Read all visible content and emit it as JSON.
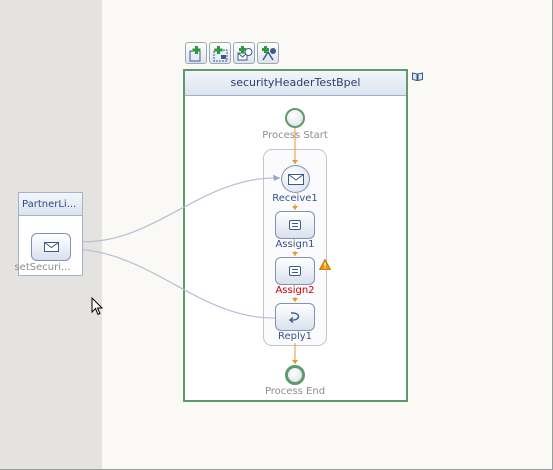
{
  "process": {
    "title": "securityHeaderTestBpel",
    "start_label": "Process Start",
    "end_label": "Process End"
  },
  "activities": {
    "receive_label": "Receive1",
    "assign1_label": "Assign1",
    "assign2_label": "Assign2",
    "reply_label": "Reply1"
  },
  "partner_link": {
    "title": "PartnerLi...",
    "operation_label": "setSecuri..."
  },
  "toolbar": {
    "buttons": [
      "add-partnerlink-icon",
      "add-variable-icon",
      "add-correlation-icon",
      "add-message-icon"
    ]
  },
  "icons": {
    "warning": "warning-icon",
    "book": "book-icon",
    "cursor": "mouse-pointer-icon"
  },
  "colors": {
    "process_border": "#5e9a6a",
    "flow_line": "#e39a32",
    "message_link": "#b6bed6",
    "error_text": "#cc0000",
    "warning": "#f29400"
  }
}
